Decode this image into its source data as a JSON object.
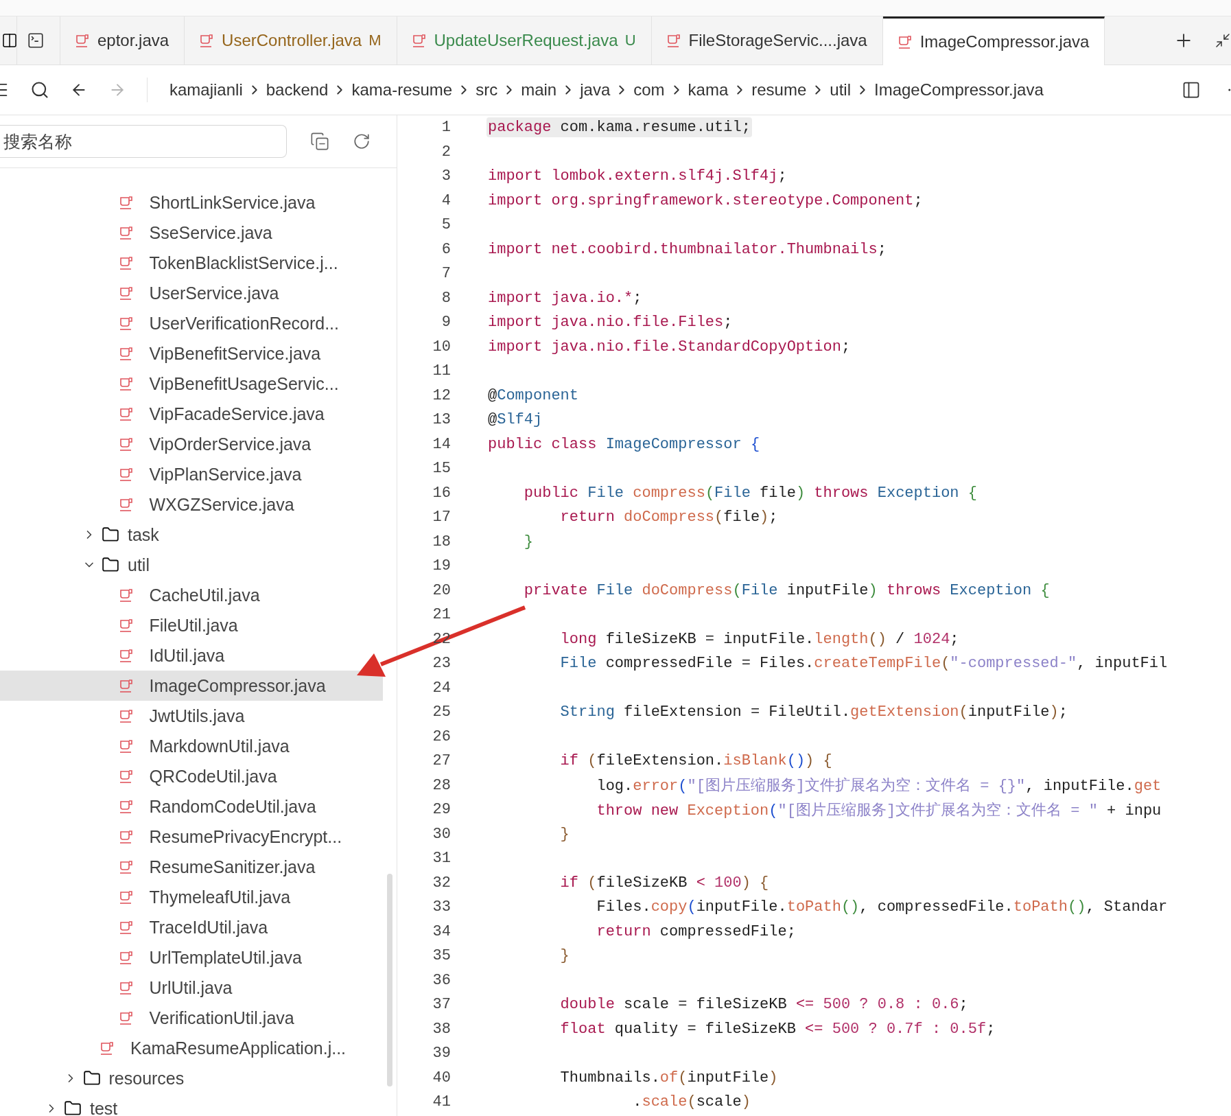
{
  "tabs": [
    {
      "kind": "icon",
      "selected": false
    },
    {
      "kind": "file",
      "label": "eptor.java",
      "selected": false
    },
    {
      "kind": "file",
      "label": "UserController.java",
      "color": "#95651b",
      "badge": "M",
      "selected": false
    },
    {
      "kind": "file",
      "label": "UpdateUserRequest.java",
      "color": "#3a8a4c",
      "badge": "U",
      "selected": false
    },
    {
      "kind": "file",
      "label": "FileStorageServic....java",
      "selected": false
    },
    {
      "kind": "file",
      "label": "ImageCompressor.java",
      "selected": true
    }
  ],
  "toolbar": {
    "forward_enabled": false,
    "breadcrumbs": [
      "kamajianli",
      "backend",
      "kama-resume",
      "src",
      "main",
      "java",
      "com",
      "kama",
      "resume",
      "util",
      "ImageCompressor.java"
    ]
  },
  "sidebar": {
    "search": {
      "placeholder": "搜索名称"
    },
    "tree": [
      {
        "children": [
          {
            "children": [
              {
                "children": [
                  {
                    "kind": "file",
                    "name": "ShortLinkService.java",
                    "selected": false
                  },
                  {
                    "kind": "file",
                    "name": "SseService.java",
                    "selected": false
                  },
                  {
                    "kind": "file",
                    "name": "TokenBlacklistService.j...",
                    "selected": false
                  },
                  {
                    "kind": "file",
                    "name": "UserService.java",
                    "selected": false
                  },
                  {
                    "kind": "file",
                    "name": "UserVerificationRecord...",
                    "selected": false
                  },
                  {
                    "kind": "file",
                    "name": "VipBenefitService.java",
                    "selected": false
                  },
                  {
                    "kind": "file",
                    "name": "VipBenefitUsageServic...",
                    "selected": false
                  },
                  {
                    "kind": "file",
                    "name": "VipFacadeService.java",
                    "selected": false
                  },
                  {
                    "kind": "file",
                    "name": "VipOrderService.java",
                    "selected": false
                  },
                  {
                    "kind": "file",
                    "name": "VipPlanService.java",
                    "selected": false
                  },
                  {
                    "kind": "file",
                    "name": "WXGZService.java",
                    "selected": false
                  }
                ]
              },
              {
                "kind": "folder",
                "name": "task",
                "expanded": false,
                "selected": false
              },
              {
                "kind": "folder",
                "name": "util",
                "expanded": true,
                "selected": false,
                "children": [
                  {
                    "kind": "file",
                    "name": "CacheUtil.java",
                    "selected": false
                  },
                  {
                    "kind": "file",
                    "name": "FileUtil.java",
                    "selected": false
                  },
                  {
                    "kind": "file",
                    "name": "IdUtil.java",
                    "selected": false
                  },
                  {
                    "kind": "file",
                    "name": "ImageCompressor.java",
                    "selected": true
                  },
                  {
                    "kind": "file",
                    "name": "JwtUtils.java",
                    "selected": false
                  },
                  {
                    "kind": "file",
                    "name": "MarkdownUtil.java",
                    "selected": false
                  },
                  {
                    "kind": "file",
                    "name": "QRCodeUtil.java",
                    "selected": false
                  },
                  {
                    "kind": "file",
                    "name": "RandomCodeUtil.java",
                    "selected": false
                  },
                  {
                    "kind": "file",
                    "name": "ResumePrivacyEncrypt...",
                    "selected": false
                  },
                  {
                    "kind": "file",
                    "name": "ResumeSanitizer.java",
                    "selected": false
                  },
                  {
                    "kind": "file",
                    "name": "ThymeleafUtil.java",
                    "selected": false
                  },
                  {
                    "kind": "file",
                    "name": "TraceIdUtil.java",
                    "selected": false
                  },
                  {
                    "kind": "file",
                    "name": "UrlTemplateUtil.java",
                    "selected": false
                  },
                  {
                    "kind": "file",
                    "name": "UrlUtil.java",
                    "selected": false
                  },
                  {
                    "kind": "file",
                    "name": "VerificationUtil.java",
                    "selected": false
                  }
                ]
              },
              {
                "kind": "file",
                "name": "KamaResumeApplication.j...",
                "selected": false
              }
            ]
          },
          {
            "kind": "folder",
            "name": "resources",
            "expanded": false,
            "selected": false
          }
        ]
      },
      {
        "kind": "folder",
        "name": "test",
        "expanded": false,
        "selected": false
      }
    ]
  },
  "editor": {
    "lines": [
      {
        "number": "1",
        "highlighted": true,
        "tokens": [
          {
            "kind": "kw",
            "text": "package"
          },
          {
            "kind": "plain",
            "text": " com.kama.resume.util;"
          }
        ]
      },
      {
        "number": "2"
      },
      {
        "number": "3",
        "tokens": [
          {
            "kind": "kw",
            "text": "import lombok.extern.slf4j.Slf4j"
          },
          {
            "kind": "plain",
            "text": ";"
          }
        ]
      },
      {
        "number": "4",
        "tokens": [
          {
            "kind": "kw",
            "text": "import org.springframework.stereotype.Component"
          },
          {
            "kind": "plain",
            "text": ";"
          }
        ]
      },
      {
        "number": "5"
      },
      {
        "number": "6",
        "tokens": [
          {
            "kind": "kw",
            "text": "import net.coobird.thumbnailator.Thumbnails"
          },
          {
            "kind": "plain",
            "text": ";"
          }
        ]
      },
      {
        "number": "7"
      },
      {
        "number": "8",
        "tokens": [
          {
            "kind": "kw",
            "text": "import java.io.*"
          },
          {
            "kind": "plain",
            "text": ";"
          }
        ]
      },
      {
        "number": "9",
        "tokens": [
          {
            "kind": "kw",
            "text": "import java.nio.file.Files"
          },
          {
            "kind": "plain",
            "text": ";"
          }
        ]
      },
      {
        "number": "10",
        "tokens": [
          {
            "kind": "kw",
            "text": "import java.nio.file.StandardCopyOption"
          },
          {
            "kind": "plain",
            "text": ";"
          }
        ]
      },
      {
        "number": "11"
      },
      {
        "number": "12",
        "tokens": [
          {
            "kind": "plain",
            "text": "@"
          },
          {
            "kind": "type",
            "text": "Component"
          }
        ]
      },
      {
        "number": "13",
        "tokens": [
          {
            "kind": "plain",
            "text": "@"
          },
          {
            "kind": "type",
            "text": "Slf4j"
          }
        ]
      },
      {
        "number": "14",
        "tokens": [
          {
            "kind": "kw",
            "text": "public class "
          },
          {
            "kind": "type",
            "text": "ImageCompressor "
          },
          {
            "kind": "br1",
            "text": "{"
          }
        ]
      },
      {
        "number": "15"
      },
      {
        "number": "16",
        "tokens": [
          {
            "kind": "kw",
            "text": "    public "
          },
          {
            "kind": "type",
            "text": "File "
          },
          {
            "kind": "fn",
            "text": "compress"
          },
          {
            "kind": "br2",
            "text": "("
          },
          {
            "kind": "type",
            "text": "File "
          },
          {
            "kind": "plain",
            "text": "file"
          },
          {
            "kind": "br2",
            "text": ")"
          },
          {
            "kind": "kw",
            "text": " throws "
          },
          {
            "kind": "type",
            "text": "Exception "
          },
          {
            "kind": "br2",
            "text": "{"
          }
        ]
      },
      {
        "number": "17",
        "tokens": [
          {
            "kind": "kw",
            "text": "        return "
          },
          {
            "kind": "fn",
            "text": "doCompress"
          },
          {
            "kind": "br3",
            "text": "("
          },
          {
            "kind": "plain",
            "text": "file"
          },
          {
            "kind": "br3",
            "text": ")"
          },
          {
            "kind": "plain",
            "text": ";"
          }
        ]
      },
      {
        "number": "18",
        "tokens": [
          {
            "kind": "br2",
            "text": "    }"
          }
        ]
      },
      {
        "number": "19"
      },
      {
        "number": "20",
        "tokens": [
          {
            "kind": "kw",
            "text": "    private "
          },
          {
            "kind": "type",
            "text": "File "
          },
          {
            "kind": "fn",
            "text": "doCompress"
          },
          {
            "kind": "br2",
            "text": "("
          },
          {
            "kind": "type",
            "text": "File "
          },
          {
            "kind": "plain",
            "text": "inputFile"
          },
          {
            "kind": "br2",
            "text": ")"
          },
          {
            "kind": "kw",
            "text": " throws "
          },
          {
            "kind": "type",
            "text": "Exception "
          },
          {
            "kind": "br2",
            "text": "{"
          }
        ]
      },
      {
        "number": "21"
      },
      {
        "number": "22",
        "tokens": [
          {
            "kind": "kw",
            "text": "        long "
          },
          {
            "kind": "plain",
            "text": "fileSizeKB = inputFile."
          },
          {
            "kind": "fn",
            "text": "length"
          },
          {
            "kind": "br3",
            "text": "()"
          },
          {
            "kind": "plain",
            "text": " / "
          },
          {
            "kind": "num",
            "text": "1024"
          },
          {
            "kind": "plain",
            "text": ";"
          }
        ]
      },
      {
        "number": "23",
        "tokens": [
          {
            "kind": "type",
            "text": "        File "
          },
          {
            "kind": "plain",
            "text": "compressedFile = Files."
          },
          {
            "kind": "fn",
            "text": "createTempFile"
          },
          {
            "kind": "br3",
            "text": "("
          },
          {
            "kind": "str",
            "text": "\"-compressed-\""
          },
          {
            "kind": "plain",
            "text": ", inputFil"
          }
        ]
      },
      {
        "number": "24"
      },
      {
        "number": "25",
        "tokens": [
          {
            "kind": "type",
            "text": "        String "
          },
          {
            "kind": "plain",
            "text": "fileExtension = FileUtil."
          },
          {
            "kind": "fn",
            "text": "getExtension"
          },
          {
            "kind": "br3",
            "text": "("
          },
          {
            "kind": "plain",
            "text": "inputFile"
          },
          {
            "kind": "br3",
            "text": ")"
          },
          {
            "kind": "plain",
            "text": ";"
          }
        ]
      },
      {
        "number": "26"
      },
      {
        "number": "27",
        "tokens": [
          {
            "kind": "kw",
            "text": "        if "
          },
          {
            "kind": "br3",
            "text": "("
          },
          {
            "kind": "plain",
            "text": "fileExtension."
          },
          {
            "kind": "fn",
            "text": "isBlank"
          },
          {
            "kind": "br1",
            "text": "()"
          },
          {
            "kind": "br3",
            "text": ") {"
          }
        ]
      },
      {
        "number": "28",
        "tokens": [
          {
            "kind": "plain",
            "text": "            log."
          },
          {
            "kind": "fn",
            "text": "error"
          },
          {
            "kind": "br1",
            "text": "("
          },
          {
            "kind": "str",
            "text": "\"[图片压缩服务]文件扩展名为空：文件名 = {}\""
          },
          {
            "kind": "plain",
            "text": ", inputFile."
          },
          {
            "kind": "fn",
            "text": "get"
          }
        ]
      },
      {
        "number": "29",
        "tokens": [
          {
            "kind": "kw",
            "text": "            throw new "
          },
          {
            "kind": "fn",
            "text": "Exception"
          },
          {
            "kind": "br1",
            "text": "("
          },
          {
            "kind": "str",
            "text": "\"[图片压缩服务]文件扩展名为空：文件名 = \""
          },
          {
            "kind": "plain",
            "text": " + inpu"
          }
        ]
      },
      {
        "number": "30",
        "tokens": [
          {
            "kind": "br3",
            "text": "        }"
          }
        ]
      },
      {
        "number": "31"
      },
      {
        "number": "32",
        "tokens": [
          {
            "kind": "kw",
            "text": "        if "
          },
          {
            "kind": "br3",
            "text": "("
          },
          {
            "kind": "plain",
            "text": "fileSizeKB "
          },
          {
            "kind": "kw",
            "text": "< "
          },
          {
            "kind": "num",
            "text": "100"
          },
          {
            "kind": "br3",
            "text": ") {"
          }
        ]
      },
      {
        "number": "33",
        "tokens": [
          {
            "kind": "plain",
            "text": "            Files."
          },
          {
            "kind": "fn",
            "text": "copy"
          },
          {
            "kind": "br1",
            "text": "("
          },
          {
            "kind": "plain",
            "text": "inputFile."
          },
          {
            "kind": "fn",
            "text": "toPath"
          },
          {
            "kind": "br2",
            "text": "()"
          },
          {
            "kind": "plain",
            "text": ", compressedFile."
          },
          {
            "kind": "fn",
            "text": "toPath"
          },
          {
            "kind": "br2",
            "text": "()"
          },
          {
            "kind": "plain",
            "text": ", Standar"
          }
        ]
      },
      {
        "number": "34",
        "tokens": [
          {
            "kind": "kw",
            "text": "            return "
          },
          {
            "kind": "plain",
            "text": "compressedFile;"
          }
        ]
      },
      {
        "number": "35",
        "tokens": [
          {
            "kind": "br3",
            "text": "        }"
          }
        ]
      },
      {
        "number": "36"
      },
      {
        "number": "37",
        "tokens": [
          {
            "kind": "kw",
            "text": "        double "
          },
          {
            "kind": "plain",
            "text": "scale = fileSizeKB "
          },
          {
            "kind": "kw",
            "text": "<= "
          },
          {
            "kind": "num",
            "text": "500 ? 0.8 : 0.6"
          },
          {
            "kind": "plain",
            "text": ";"
          }
        ]
      },
      {
        "number": "38",
        "tokens": [
          {
            "kind": "kw",
            "text": "        float "
          },
          {
            "kind": "plain",
            "text": "quality = fileSizeKB "
          },
          {
            "kind": "kw",
            "text": "<= "
          },
          {
            "kind": "num",
            "text": "500 ? 0.7f : 0.5f"
          },
          {
            "kind": "plain",
            "text": ";"
          }
        ]
      },
      {
        "number": "39"
      },
      {
        "number": "40",
        "tokens": [
          {
            "kind": "plain",
            "text": "        Thumbnails."
          },
          {
            "kind": "fn",
            "text": "of"
          },
          {
            "kind": "br3",
            "text": "("
          },
          {
            "kind": "plain",
            "text": "inputFile"
          },
          {
            "kind": "br3",
            "text": ")"
          }
        ]
      },
      {
        "number": "41",
        "tokens": [
          {
            "kind": "plain",
            "text": "                ."
          },
          {
            "kind": "fn",
            "text": "scale"
          },
          {
            "kind": "br3",
            "text": "("
          },
          {
            "kind": "plain",
            "text": "scale"
          },
          {
            "kind": "br3",
            "text": ")"
          }
        ]
      }
    ]
  }
}
